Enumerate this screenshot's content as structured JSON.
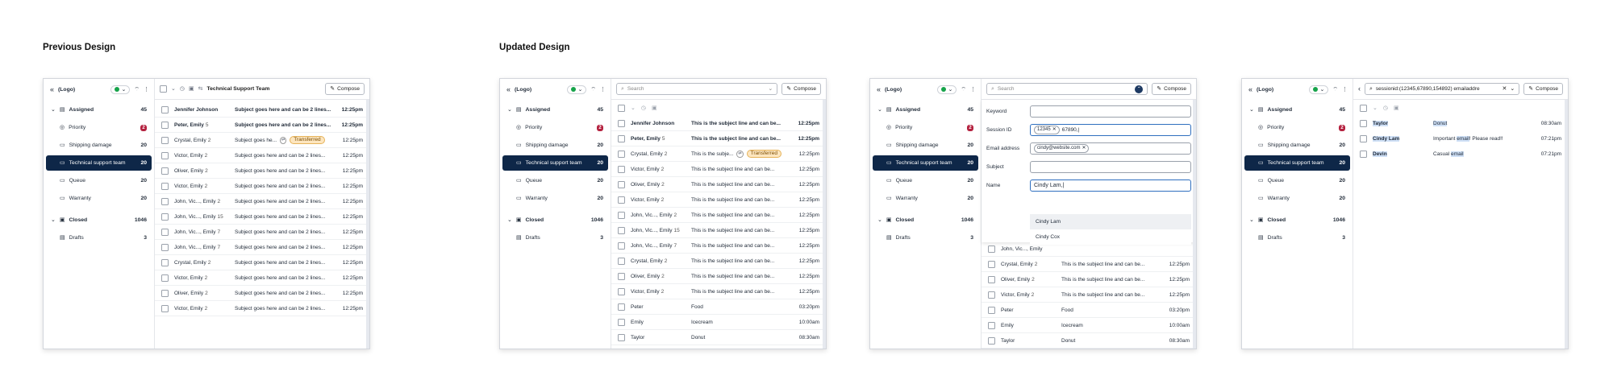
{
  "titles": {
    "previous": "Previous Design",
    "updated": "Updated Design"
  },
  "brand": {
    "logo": "(Logo)",
    "compose": "Compose",
    "search_placeholder": "Search"
  },
  "nav": [
    {
      "label": "Assigned",
      "count": "45",
      "kind": "group-open"
    },
    {
      "label": "Priority",
      "count": "2",
      "kind": "badge"
    },
    {
      "label": "Shipping damage",
      "count": "20",
      "kind": "folder"
    },
    {
      "label": "Technical support team",
      "count": "20",
      "kind": "folder-selected"
    },
    {
      "label": "Queue",
      "count": "20",
      "kind": "folder"
    },
    {
      "label": "Warranty",
      "count": "20",
      "kind": "folder"
    },
    {
      "label": "Closed",
      "count": "1046",
      "kind": "group-closed"
    },
    {
      "label": "Drafts",
      "count": "3",
      "kind": "drafts"
    }
  ],
  "previous": {
    "header_title": "Technical Support Team",
    "rows": [
      {
        "name": "Jennifer Johnson",
        "count": "",
        "subject": "Subject goes here and can be 2 lines...",
        "time": "12:25pm",
        "bold": true
      },
      {
        "name": "Peter, Emily",
        "count": "5",
        "subject": "Subject goes here and can be 2 lines...",
        "time": "12:25pm",
        "bold": true
      },
      {
        "name": "Crystal, Emily",
        "count": "2",
        "subject": "Subject goes he...",
        "time": "12:25pm",
        "bold": false,
        "tag": "Transferred"
      },
      {
        "name": "Victor, Emily",
        "count": "2",
        "subject": "Subject goes here and can be 2 lines...",
        "time": "12:25pm"
      },
      {
        "name": "Oliver, Emily",
        "count": "2",
        "subject": "Subject goes here and can be 2 lines...",
        "time": "12:25pm"
      },
      {
        "name": "Victor, Emily",
        "count": "2",
        "subject": "Subject goes here and can be 2 lines...",
        "time": "12:25pm"
      },
      {
        "name": "John, Vic..., Emily",
        "count": "2",
        "subject": "Subject goes here and can be 2 lines...",
        "time": "12:25pm"
      },
      {
        "name": "John, Vic..., Emily",
        "count": "15",
        "subject": "Subject goes here and can be 2 lines...",
        "time": "12:25pm"
      },
      {
        "name": "John, Vic..., Emily",
        "count": "7",
        "subject": "Subject goes here and can be 2 lines...",
        "time": "12:25pm"
      },
      {
        "name": "John, Vic..., Emily",
        "count": "7",
        "subject": "Subject goes here and can be 2 lines...",
        "time": "12:25pm"
      },
      {
        "name": "Crystal, Emily",
        "count": "2",
        "subject": "Subject goes here and can be 2 lines...",
        "time": "12:25pm"
      },
      {
        "name": "Victor, Emily",
        "count": "2",
        "subject": "Subject goes here and can be 2 lines...",
        "time": "12:25pm"
      },
      {
        "name": "Oliver, Emily",
        "count": "2",
        "subject": "Subject goes here and can be 2 lines...",
        "time": "12:25pm"
      },
      {
        "name": "Victor, Emily",
        "count": "2",
        "subject": "Subject goes here and can be 2 lines...",
        "time": "12:25pm"
      }
    ]
  },
  "updated": {
    "rows": [
      {
        "name": "Jennifer Johnson",
        "count": "",
        "subject": "This is the subject line and can be...",
        "time": "12:25pm",
        "bold": true
      },
      {
        "name": "Peter, Emily",
        "count": "5",
        "subject": "This is the subject line and can be...",
        "time": "12:25pm",
        "bold": true
      },
      {
        "name": "Crystal, Emily",
        "count": "2",
        "subject": "This is the subje...",
        "time": "12:25pm",
        "tag": "Transferred"
      },
      {
        "name": "Victor, Emily",
        "count": "2",
        "subject": "This is the subject line and can be...",
        "time": "12:25pm"
      },
      {
        "name": "Oliver, Emily",
        "count": "2",
        "subject": "This is the subject line and can be...",
        "time": "12:25pm"
      },
      {
        "name": "Victor, Emily",
        "count": "2",
        "subject": "This is the subject line and can be...",
        "time": "12:25pm"
      },
      {
        "name": "John, Vic..., Emily",
        "count": "2",
        "subject": "This is the subject line and can be...",
        "time": "12:25pm"
      },
      {
        "name": "John, Vic..., Emily",
        "count": "15",
        "subject": "This is the subject line and can be...",
        "time": "12:25pm"
      },
      {
        "name": "John, Vic..., Emily",
        "count": "7",
        "subject": "This is the subject line and can be...",
        "time": "12:25pm"
      },
      {
        "name": "Crystal, Emily",
        "count": "2",
        "subject": "This is the subject line and can be...",
        "time": "12:25pm"
      },
      {
        "name": "Oliver, Emily",
        "count": "2",
        "subject": "This is the subject line and can be...",
        "time": "12:25pm"
      },
      {
        "name": "Victor, Emily",
        "count": "2",
        "subject": "This is the subject line and can be...",
        "time": "12:25pm"
      },
      {
        "name": "Peter",
        "count": "",
        "subject": "Food",
        "time": "03:20pm"
      },
      {
        "name": "Emily",
        "count": "",
        "subject": "Icecream",
        "time": "10:00am"
      },
      {
        "name": "Taylor",
        "count": "",
        "subject": "Donut",
        "time": "08:30am"
      }
    ]
  },
  "advanced": {
    "fields": {
      "keyword": "Keyword",
      "session": "Session ID",
      "email": "Email address",
      "subject": "Subject",
      "name": "Name"
    },
    "session_chip": "12345",
    "session_value": "67890,|",
    "email_chip": "cindy@website.com",
    "name_value": "Cindy Lam,|",
    "suggestions": [
      "Cindy Lam",
      "Cindy Cox"
    ],
    "rows": [
      {
        "name": "John, Vic..., Emily",
        "count": "",
        "subject": "",
        "time": ""
      },
      {
        "name": "Crystal, Emily",
        "count": "2",
        "subject": "This is the subject line and can be...",
        "time": "12:25pm"
      },
      {
        "name": "Oliver, Emily",
        "count": "2",
        "subject": "This is the subject line and can be...",
        "time": "12:25pm"
      },
      {
        "name": "Victor, Emily",
        "count": "2",
        "subject": "This is the subject line and can be...",
        "time": "12:25pm"
      },
      {
        "name": "Peter",
        "count": "",
        "subject": "Food",
        "time": "03:20pm"
      },
      {
        "name": "Emily",
        "count": "",
        "subject": "Icecream",
        "time": "10:00am"
      },
      {
        "name": "Taylor",
        "count": "",
        "subject": "Donut",
        "time": "08:30am"
      }
    ]
  },
  "results": {
    "query": "sessionid:(12345,67890,154892) emailaddre",
    "rows": [
      {
        "name": "Taylor",
        "pre": "",
        "hl": "Donut",
        "post": "",
        "time": "08:30am"
      },
      {
        "name": "Cindy Lam",
        "pre": "Important ",
        "hl": "email",
        "post": "! Please read!!",
        "time": "07:21pm"
      },
      {
        "name": "Devin",
        "pre": "Casual ",
        "hl": "email",
        "post": "",
        "time": "07:21pm"
      }
    ]
  }
}
